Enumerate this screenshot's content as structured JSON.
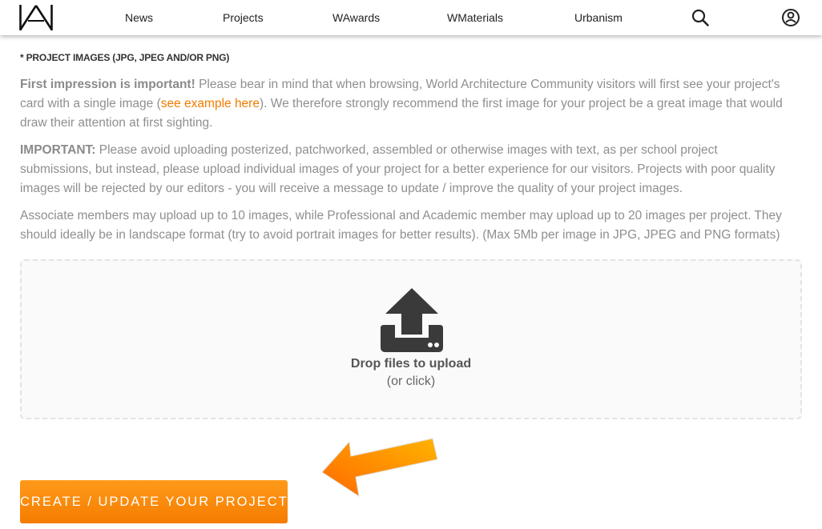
{
  "header": {
    "logo_icon": "wa-logo-icon",
    "nav": [
      {
        "label": "News"
      },
      {
        "label": "Projects"
      },
      {
        "label": "WAwards"
      },
      {
        "label": "WMaterials"
      },
      {
        "label": "Urbanism"
      }
    ],
    "search_icon": "search-icon",
    "account_icon": "user-account-icon"
  },
  "main": {
    "section_label": "* PROJECT IMAGES (JPG, JPEG AND/OR PNG)",
    "impression": {
      "bold": "First impression is important!",
      "text_before_link": " Please bear in mind that when browsing, World Architecture Community visitors will first see your project's card with a single image (",
      "link": "see example here",
      "text_after_link": "). We therefore strongly recommend the first image for your project be a great image that would draw their attention at first sighting."
    },
    "important": {
      "bold": "IMPORTANT:",
      "text": " Please avoid uploading posterized, patchworked, assembled or otherwise images with text, as per school project submissions, but instead, please upload individual images of your project for a better experience for our visitors. Projects with poor quality images will be rejected by our editors - you will receive a message to update / improve the quality of your project images."
    },
    "limits_text": "Associate members may upload up to 10 images, while Professional and Academic member may upload up to 20 images per project. They should ideally be in landscape format (try to avoid portrait images for better results). (Max 5Mb per image in JPG, JPEG and PNG formats)",
    "dropzone": {
      "icon": "upload-icon",
      "title": "Drop files to upload",
      "subtitle": "(or click)"
    },
    "arrow_icon": "orange-arrow-icon",
    "create_button": "CREATE / UPDATE YOUR PROJECT"
  },
  "colors": {
    "accent": "#f57c00",
    "link": "#f07b00",
    "text_gray": "#8f8f8f"
  }
}
